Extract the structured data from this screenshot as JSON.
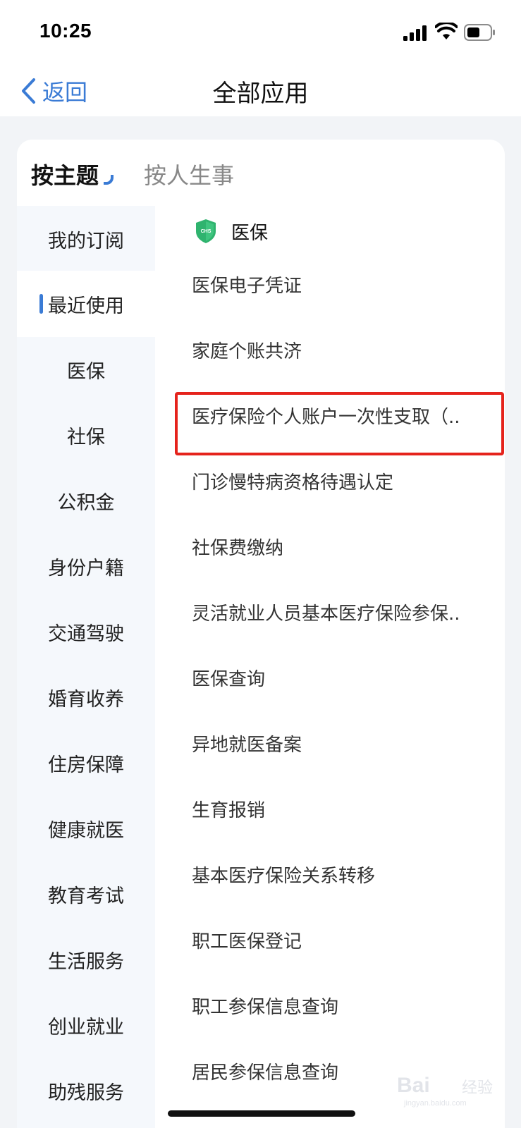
{
  "status_bar": {
    "time": "10:25",
    "icons": [
      "signal-icon",
      "wifi-icon",
      "battery-icon"
    ]
  },
  "nav": {
    "back_label": "返回",
    "title": "全部应用"
  },
  "mode_tabs": [
    {
      "label": "按主题",
      "active": true
    },
    {
      "label": "按人生事",
      "active": false
    }
  ],
  "sidebar": {
    "items": [
      {
        "label": "我的订阅"
      },
      {
        "label": "最近使用",
        "active": true
      },
      {
        "label": "医保"
      },
      {
        "label": "社保"
      },
      {
        "label": "公积金"
      },
      {
        "label": "身份户籍"
      },
      {
        "label": "交通驾驶"
      },
      {
        "label": "婚育收养"
      },
      {
        "label": "住房保障"
      },
      {
        "label": "健康就医"
      },
      {
        "label": "教育考试"
      },
      {
        "label": "生活服务"
      },
      {
        "label": "创业就业"
      },
      {
        "label": "助残服务"
      }
    ]
  },
  "list": {
    "group_label": "医保",
    "group_icon_text": "CHS",
    "items": [
      {
        "label": "医保电子凭证"
      },
      {
        "label": "家庭个账共济"
      },
      {
        "label": "医疗保险个人账户一次性支取（.."
      },
      {
        "label": "门诊慢特病资格待遇认定"
      },
      {
        "label": "社保费缴纳"
      },
      {
        "label": "灵活就业人员基本医疗保险参保.."
      },
      {
        "label": "医保查询"
      },
      {
        "label": "异地就医备案"
      },
      {
        "label": "生育报销"
      },
      {
        "label": "基本医疗保险关系转移"
      },
      {
        "label": "职工医保登记"
      },
      {
        "label": "职工参保信息查询"
      },
      {
        "label": "居民参保信息查询"
      }
    ]
  },
  "watermark": {
    "text": "Bai",
    "text2": "经验",
    "sub": "jingyan.baidu.com"
  },
  "colors": {
    "accent": "#3a7bd5",
    "highlight": "#e5231c",
    "background": "#f2f4f7",
    "sidebar": "#f5f8fc"
  }
}
